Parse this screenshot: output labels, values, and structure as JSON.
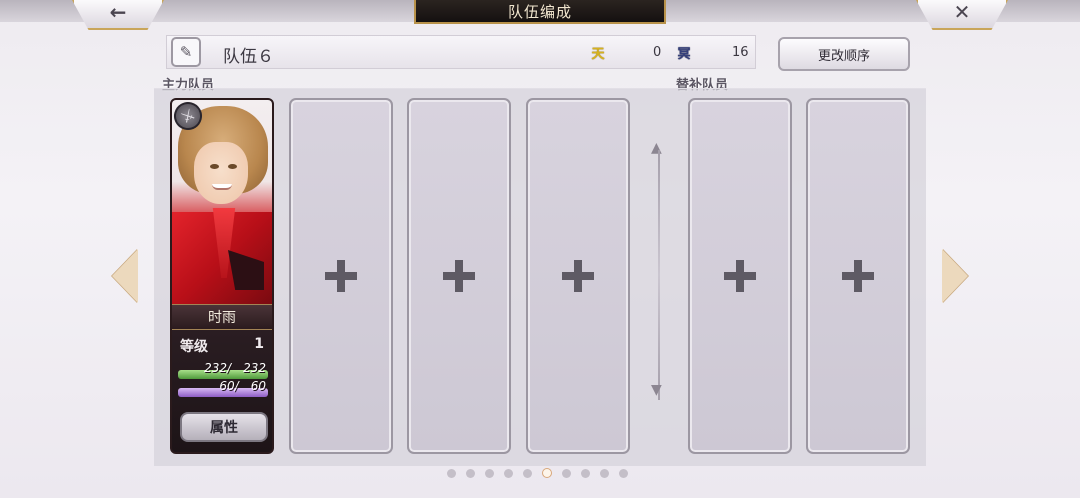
{
  "header": {
    "title": "队伍编成",
    "back_icon": "back-arrow-icon",
    "close_icon": "close-icon"
  },
  "team": {
    "name": "队伍６",
    "resources": [
      {
        "icon": "heaven-icon",
        "glyph": "天",
        "value": "0",
        "color": "#d7b21d"
      },
      {
        "icon": "underworld-icon",
        "glyph": "冥",
        "value": "16",
        "color": "#36407c"
      }
    ],
    "order_button_label": "更改顺序"
  },
  "sections": {
    "main_label": "主力队员",
    "sub_label": "替补队员"
  },
  "character": {
    "name": "时雨",
    "level_label": "等级",
    "level": "1",
    "hp_text": "232/　232",
    "mp_text": "60/　60",
    "attribute_button_label": "属性",
    "weapon_icon": "sword-icon"
  },
  "empty_slots": {
    "main_count": 3,
    "sub_count": 2,
    "icon": "plus-icon"
  },
  "pagination": {
    "total_pages": 10,
    "current_page": 6
  }
}
